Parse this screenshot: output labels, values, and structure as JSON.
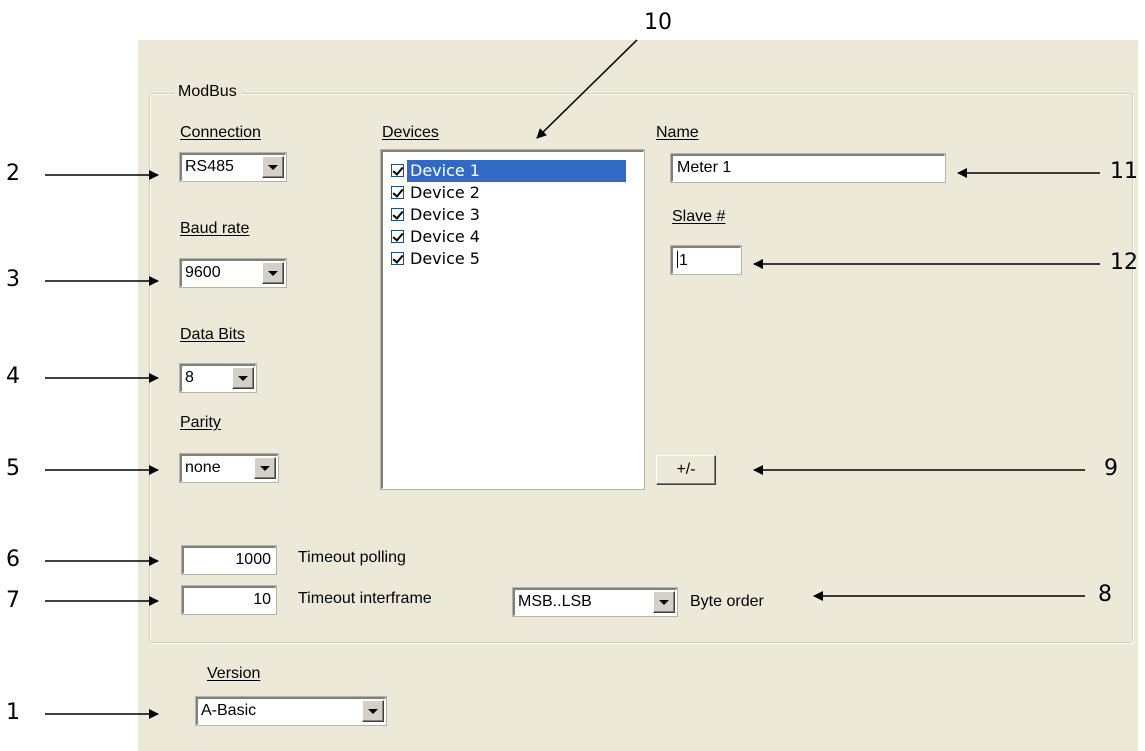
{
  "group": {
    "title": "ModBus"
  },
  "connection": {
    "label": "Connection",
    "value": "RS485"
  },
  "baud_rate": {
    "label": "Baud rate",
    "value": "9600"
  },
  "data_bits": {
    "label": "Data Bits",
    "value": "8"
  },
  "parity": {
    "label": "Parity",
    "value": "none"
  },
  "devices": {
    "label": "Devices",
    "items": [
      {
        "label": "Device  1",
        "checked": true,
        "selected": true
      },
      {
        "label": "Device  2",
        "checked": true,
        "selected": false
      },
      {
        "label": "Device  3",
        "checked": true,
        "selected": false
      },
      {
        "label": "Device  4",
        "checked": true,
        "selected": false
      },
      {
        "label": "Device  5",
        "checked": true,
        "selected": false
      }
    ]
  },
  "name": {
    "label": "Name",
    "value": "Meter 1"
  },
  "slave": {
    "label": "Slave #",
    "value": "1"
  },
  "plus_minus": {
    "label": "+/-"
  },
  "timeout_polling": {
    "value": "1000",
    "label": "Timeout polling"
  },
  "timeout_interframe": {
    "value": "10",
    "label": "Timeout interframe"
  },
  "byte_order": {
    "value": "MSB..LSB",
    "label": "Byte order"
  },
  "version": {
    "label": "Version",
    "value": "A-Basic"
  },
  "callouts": [
    "1",
    "2",
    "3",
    "4",
    "5",
    "6",
    "7",
    "8",
    "9",
    "10",
    "11",
    "12"
  ]
}
